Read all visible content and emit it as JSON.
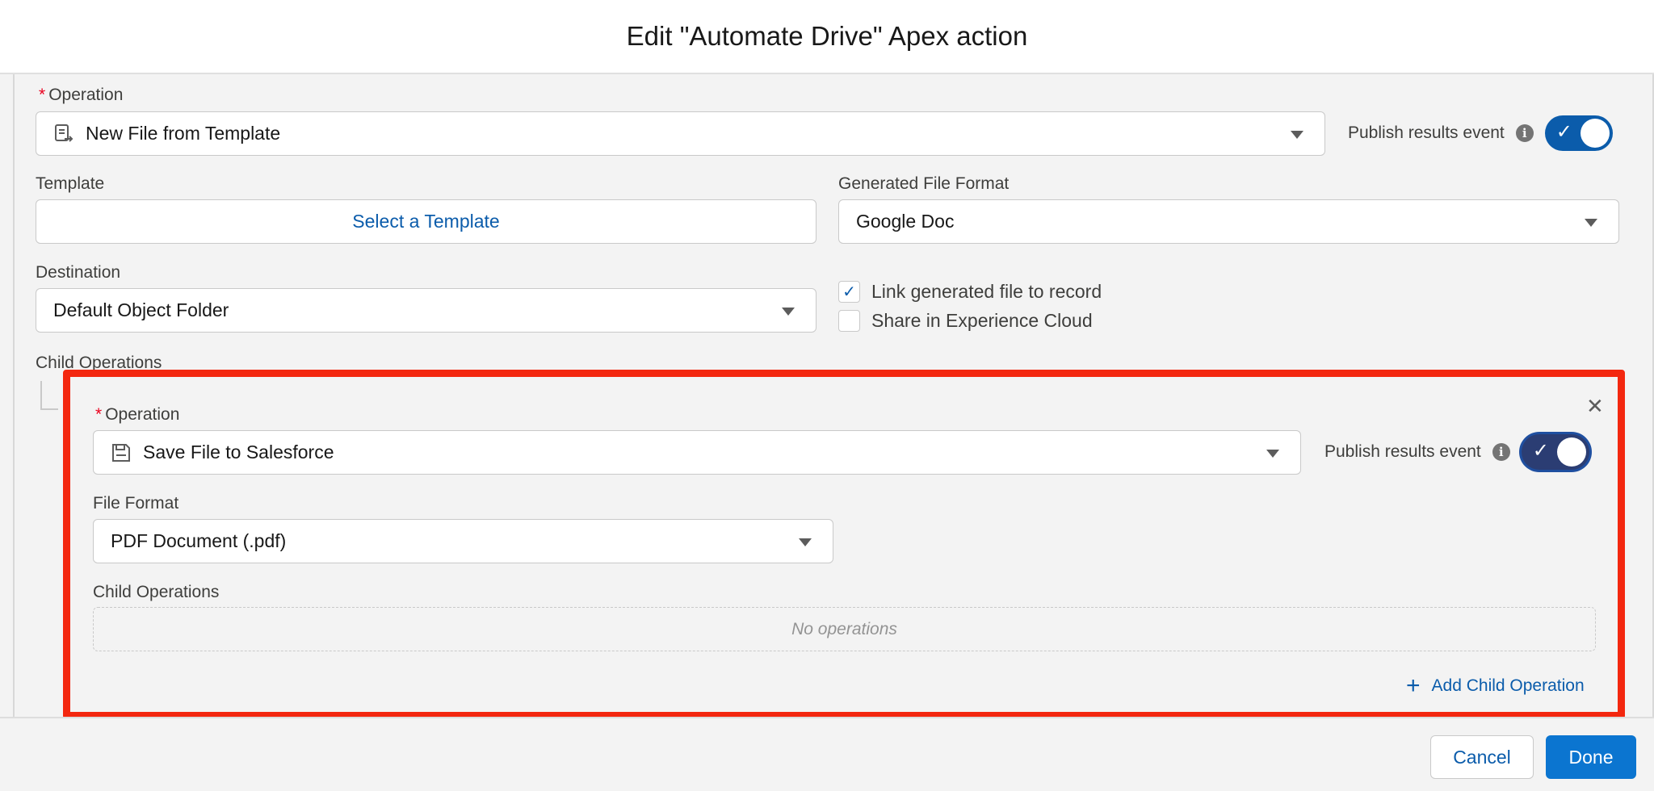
{
  "modal": {
    "title": "Edit \"Automate Drive\" Apex action"
  },
  "form": {
    "operation": {
      "label": "Operation",
      "required_marker": "*",
      "value": "New File from Template",
      "icon": "template-doc-icon"
    },
    "publish": {
      "label": "Publish results event",
      "info_icon": "info-icon",
      "checked": true
    },
    "template": {
      "label": "Template",
      "button": "Select a Template"
    },
    "file_format": {
      "label": "Generated File Format",
      "value": "Google Doc"
    },
    "destination": {
      "label": "Destination",
      "value": "Default Object Folder"
    },
    "checkboxes": [
      {
        "label": "Link generated file to record",
        "checked": true
      },
      {
        "label": "Share in Experience Cloud",
        "checked": false
      }
    ],
    "child_operations_label": "Child Operations"
  },
  "child": {
    "operation": {
      "label": "Operation",
      "required_marker": "*",
      "value": "Save File to Salesforce",
      "icon": "save-disk-icon"
    },
    "publish": {
      "label": "Publish results event",
      "checked": true
    },
    "file_format": {
      "label": "File Format",
      "value": "PDF Document (.pdf)"
    },
    "child_operations": {
      "label": "Child Operations",
      "empty_text": "No operations"
    },
    "add_child": "Add Child Operation",
    "close_icon": "close-icon"
  },
  "footer": {
    "cancel": "Cancel",
    "done": "Done"
  },
  "colors": {
    "brand": "#0b75d0",
    "link": "#0b5cab",
    "highlight": "#f3270f",
    "required": "#ea001e"
  }
}
